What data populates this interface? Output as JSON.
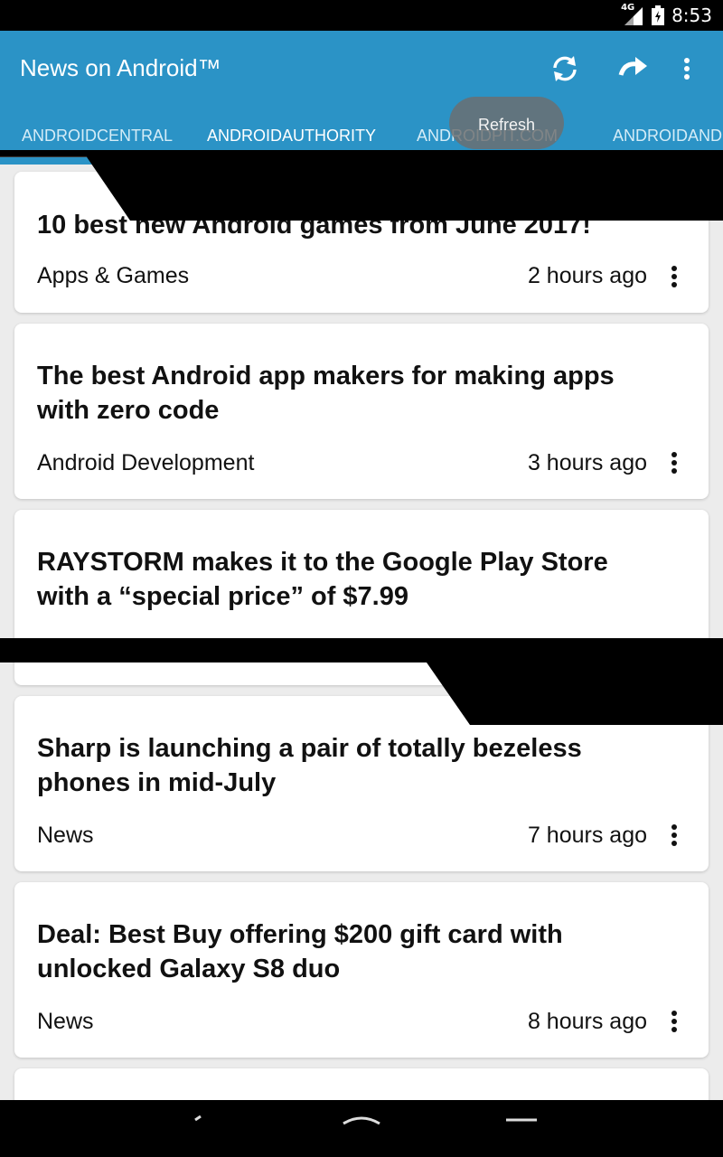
{
  "status_bar": {
    "network": "4G",
    "time": "8:53"
  },
  "app_bar": {
    "title": "News on Android™",
    "actions": [
      {
        "name": "refresh",
        "icon": "refresh-icon"
      },
      {
        "name": "forward",
        "icon": "forward-arrow-icon"
      },
      {
        "name": "overflow",
        "icon": "more-vert-icon"
      }
    ]
  },
  "tabs": [
    {
      "label": "ANDROIDCENTRAL",
      "active": false
    },
    {
      "label": "ANDROIDAUTHORITY",
      "active": true
    },
    {
      "label": "ANDROIDPIT.COM",
      "active": false
    },
    {
      "label": "ANDROIDAND",
      "active": false
    }
  ],
  "tooltip": "Refresh",
  "articles": [
    {
      "title": "10 best new Android games from June 2017!",
      "category": "Apps & Games",
      "time": "2 hours ago"
    },
    {
      "title": "The best Android app makers for making apps with zero code",
      "category": "Android Development",
      "time": "3 hours ago"
    },
    {
      "title": "RAYSTORM makes it to the Google Play Store with a “special price” of $7.99",
      "category": "",
      "time": ""
    },
    {
      "title": "Sharp is launching a pair of totally bezeless phones in mid-July",
      "category": "News",
      "time": "7 hours ago"
    },
    {
      "title": "Deal: Best Buy offering $200 gift card with unlocked Galaxy S8 duo",
      "category": "News",
      "time": "8 hours ago"
    }
  ],
  "colors": {
    "primary": "#2b93c6",
    "background": "#ececec",
    "card": "#ffffff",
    "text": "#111111"
  }
}
